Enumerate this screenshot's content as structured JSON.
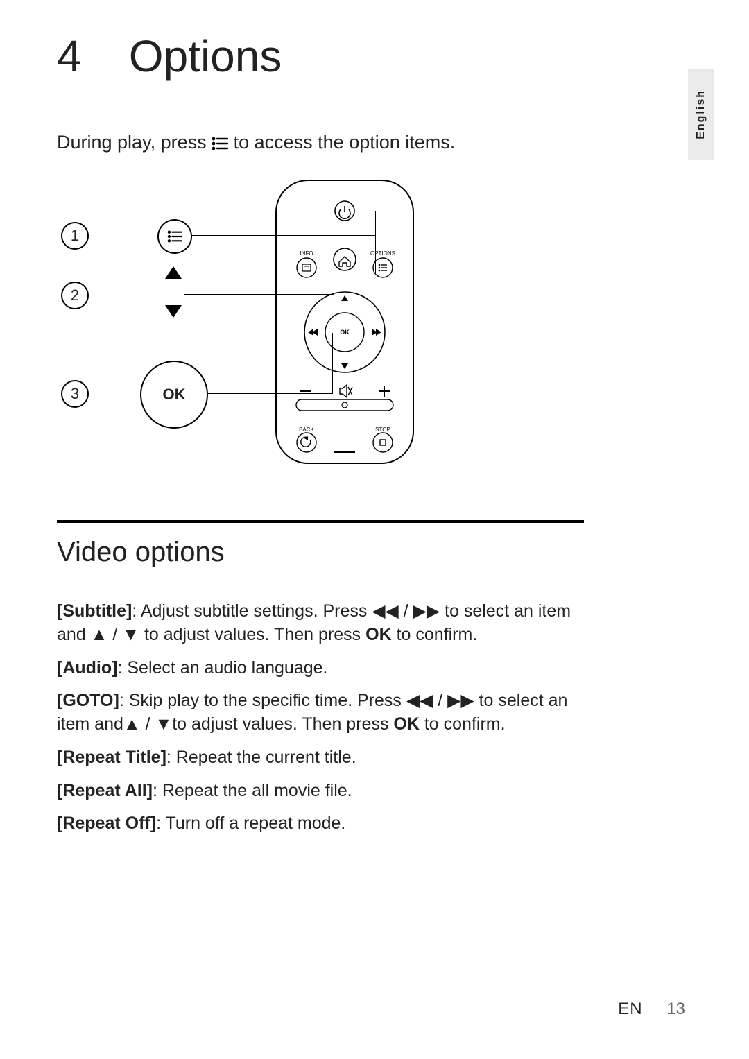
{
  "chapter": {
    "number": "4",
    "title": "Options"
  },
  "intro": {
    "before": "During play, press ",
    "after": " to access the option items."
  },
  "callouts": {
    "c1": "1",
    "c2": "2",
    "c3": "3",
    "ok": "OK"
  },
  "remote": {
    "info": "INFO",
    "options": "OPTIONS",
    "ok": "OK",
    "back": "BACK",
    "stop": "STOP"
  },
  "section": {
    "title": "Video options"
  },
  "options": {
    "subtitle": {
      "label": "[Subtitle]",
      "t1": ": Adjust subtitle settings. Press ",
      "t2": " to select an item and ",
      "t3": " to adjust values. Then press ",
      "ok": "OK",
      "t4": " to confirm."
    },
    "audio": {
      "label": "[Audio]",
      "text": ": Select an audio language."
    },
    "goto": {
      "label": "[GOTO]",
      "t1": ": Skip play to the specific time. Press ",
      "t2": " to select an item and",
      "t3": "to adjust values. Then press ",
      "ok": "OK",
      "t4": " to confirm."
    },
    "repeat_title": {
      "label": "[Repeat Title]",
      "text": ": Repeat the current title."
    },
    "repeat_all": {
      "label": "[Repeat All]",
      "text": ": Repeat the all movie file."
    },
    "repeat_off": {
      "label": "[Repeat Off]",
      "text": ": Turn off a repeat mode."
    }
  },
  "glyphs": {
    "rewfwd": "◀◀ / ▶▶",
    "updown": "▲ / ▼"
  },
  "language_tab": "English",
  "footer": {
    "lang": "EN",
    "page": "13"
  }
}
